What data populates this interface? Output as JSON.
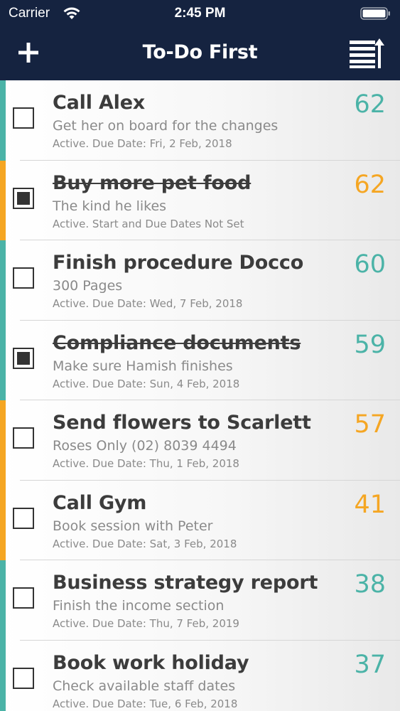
{
  "status_bar": {
    "carrier": "Carrier",
    "time": "2:45 PM",
    "wifi_icon": "wifi-icon",
    "battery_icon": "battery-icon"
  },
  "nav": {
    "title": "To-Do First",
    "add_icon": "plus-icon",
    "sort_icon": "sort-icon"
  },
  "colors": {
    "nav_background": "#152340",
    "teal": "#4bb3a7",
    "orange": "#f5a623"
  },
  "tasks": [
    {
      "title": "Call Alex",
      "subtitle": "Get her on board for the changes",
      "status": "Active. Due Date: Fri, 2 Feb, 2018",
      "score": "62",
      "color": "#4bb3a7",
      "checked": false
    },
    {
      "title": "Buy more pet food",
      "subtitle": "The kind he likes",
      "status": "Active. Start and Due Dates Not Set",
      "score": "62",
      "color": "#f5a623",
      "checked": true
    },
    {
      "title": "Finish procedure Docco",
      "subtitle": "300 Pages",
      "status": "Active. Due Date: Wed, 7 Feb, 2018",
      "score": "60",
      "color": "#4bb3a7",
      "checked": false
    },
    {
      "title": "Compliance documents",
      "subtitle": "Make sure Hamish finishes",
      "status": "Active. Due Date: Sun, 4 Feb, 2018",
      "score": "59",
      "color": "#4bb3a7",
      "checked": true
    },
    {
      "title": "Send flowers to Scarlett",
      "subtitle": "Roses Only (02) 8039 4494",
      "status": "Active. Due Date: Thu, 1 Feb, 2018",
      "score": "57",
      "color": "#f5a623",
      "checked": false
    },
    {
      "title": "Call Gym",
      "subtitle": "Book session with Peter",
      "status": "Active. Due Date: Sat, 3 Feb, 2018",
      "score": "41",
      "color": "#f5a623",
      "checked": false
    },
    {
      "title": "Business strategy report",
      "subtitle": "Finish the income section",
      "status": "Active. Due Date: Thu, 7 Feb, 2019",
      "score": "38",
      "color": "#4bb3a7",
      "checked": false
    },
    {
      "title": "Book work holiday",
      "subtitle": "Check available staff dates",
      "status": "Active. Due Date: Tue, 6 Feb, 2018",
      "score": "37",
      "color": "#4bb3a7",
      "checked": false
    }
  ]
}
